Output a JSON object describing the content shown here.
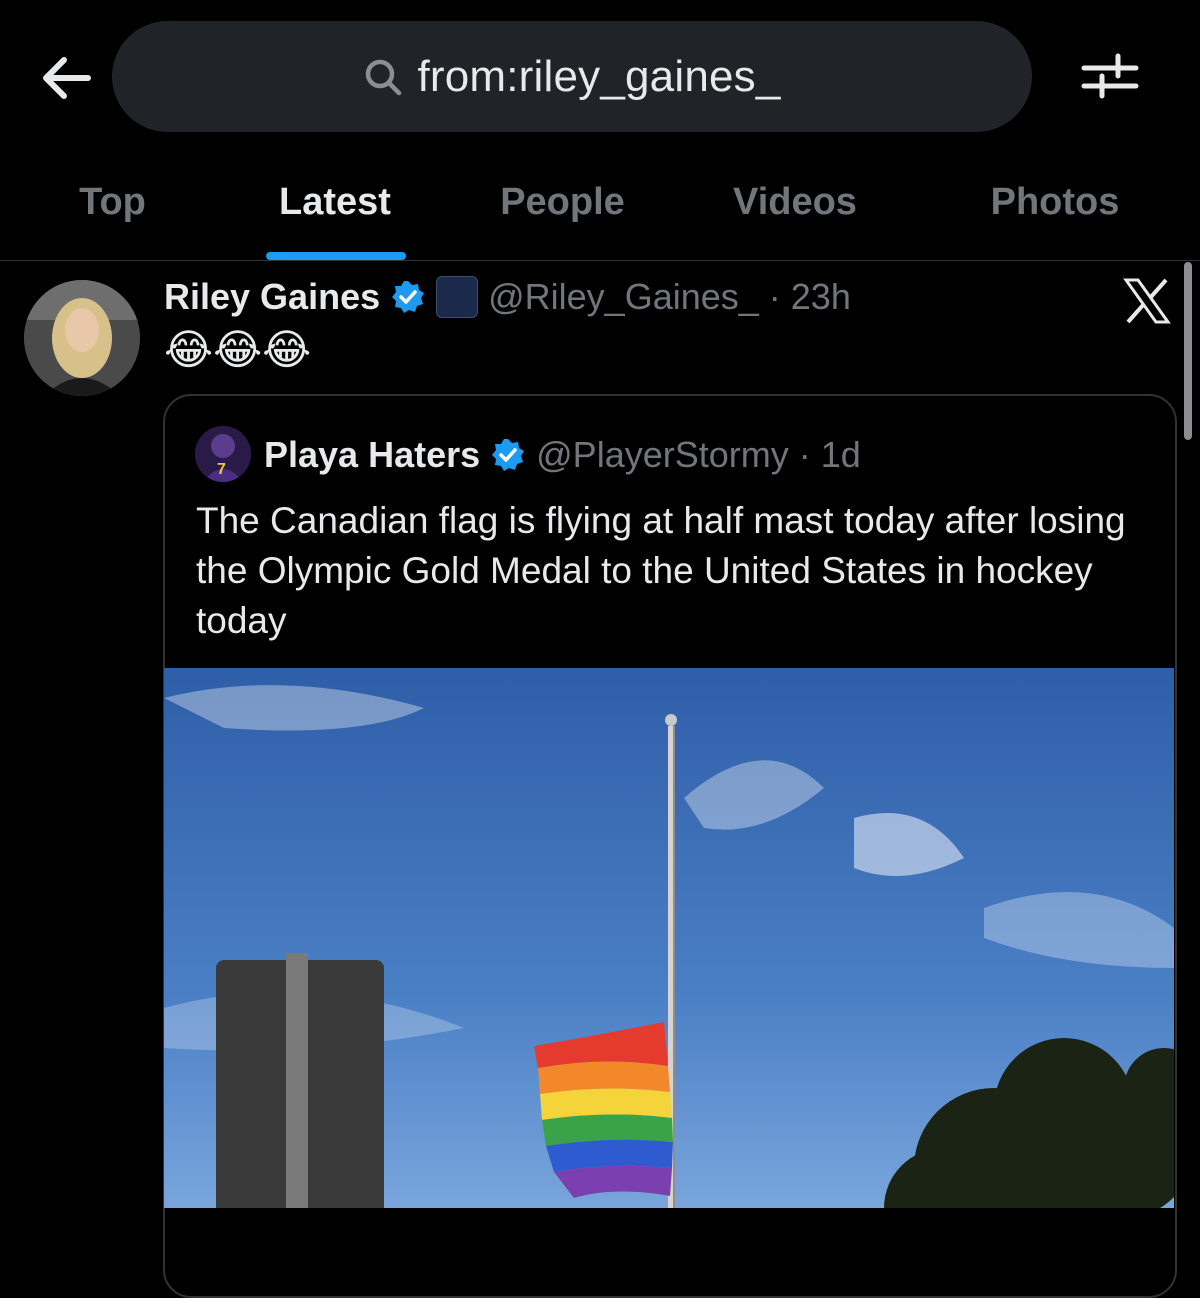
{
  "header": {
    "back_icon": "arrow-left-icon",
    "search": {
      "query": "from:riley_gaines_",
      "icon": "search-icon"
    },
    "filter_icon": "sliders-icon"
  },
  "tabs": [
    {
      "label": "Top",
      "active": false
    },
    {
      "label": "Latest",
      "active": true
    },
    {
      "label": "People",
      "active": false
    },
    {
      "label": "Videos",
      "active": false
    },
    {
      "label": "Photos",
      "active": false
    }
  ],
  "tweet": {
    "author_name": "Riley Gaines",
    "handle": "@Riley_Gaines_",
    "separator": "·",
    "time": "23h",
    "verified": true,
    "text": "😂😂😂",
    "source_icon": "x-logo-icon",
    "quote": {
      "author_name": "Playa Haters",
      "handle": "@PlayerStormy",
      "separator": "·",
      "time": "1d",
      "verified": true,
      "text": "The Canadian flag is flying at half mast today after losing the Olympic Gold Medal to the United States in hockey today",
      "media": "photo-flagpole-rainbow-flag"
    }
  },
  "colors": {
    "background": "#000000",
    "accent": "#1d9bf0",
    "muted": "#71767b",
    "text": "#e7e9ea",
    "search_bg": "#202327"
  }
}
